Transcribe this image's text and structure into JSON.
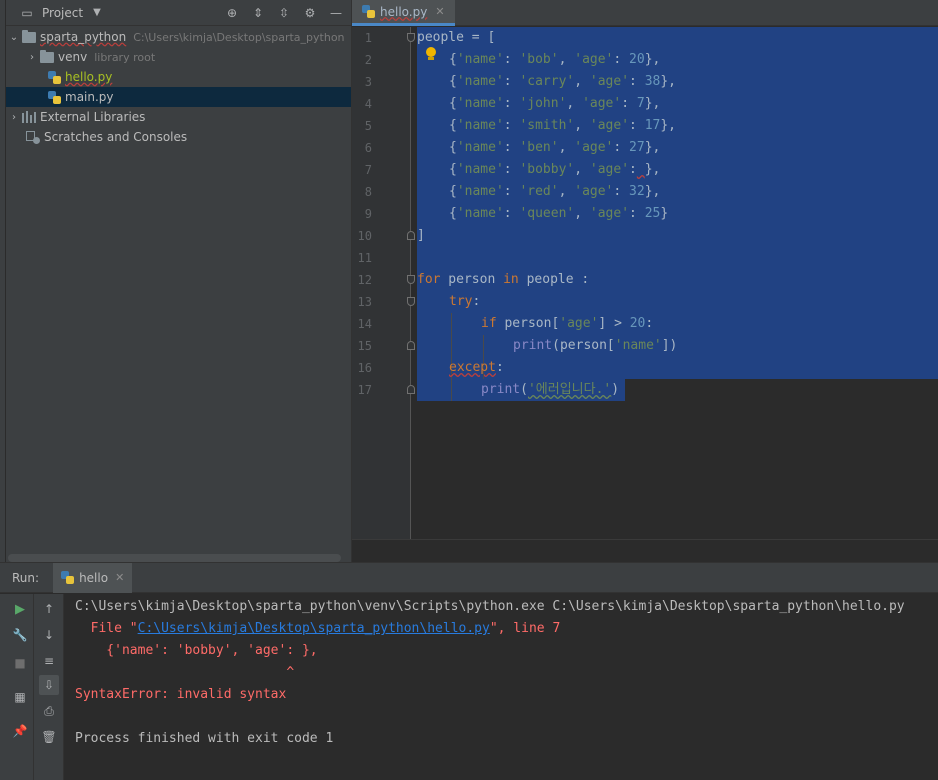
{
  "project": {
    "title": "Project",
    "root_name": "sparta_python",
    "root_path": "C:\\Users\\kimja\\Desktop\\sparta_python",
    "items": [
      {
        "label": "venv",
        "hint": "library root"
      },
      {
        "label": "hello.py"
      },
      {
        "label": "main.py"
      },
      {
        "label": "External Libraries"
      },
      {
        "label": "Scratches and Consoles"
      }
    ]
  },
  "editor": {
    "tab": "hello.py",
    "line_numbers": [
      "1",
      "2",
      "3",
      "4",
      "5",
      "6",
      "7",
      "8",
      "9",
      "10",
      "11",
      "12",
      "13",
      "14",
      "15",
      "16",
      "17"
    ],
    "code": {
      "l1": "people = [",
      "people_list": [
        {
          "name": "'bob'",
          "age": "20"
        },
        {
          "name": "'carry'",
          "age": "38"
        },
        {
          "name": "'john'",
          "age": "7"
        },
        {
          "name": "'smith'",
          "age": "17"
        },
        {
          "name": "'ben'",
          "age": "27"
        },
        {
          "name": "'bobby'",
          "age": ""
        },
        {
          "name": "'red'",
          "age": "32"
        },
        {
          "name": "'queen'",
          "age": "25"
        }
      ],
      "close_bracket": "]",
      "for_kw": "for",
      "for_var": " person ",
      "in_kw": "in",
      "for_rest": " people :",
      "try_kw": "try",
      "if_kw": "if",
      "if_cond_a": " person[",
      "if_cond_str": "'age'",
      "if_cond_b": "] > ",
      "if_num": "20",
      "print_fn": "print",
      "print_inner_a": "(person[",
      "print_inner_str": "'name'",
      "print_inner_b": "])",
      "except_kw": "except",
      "print2_str": "'에러입니다.'"
    }
  },
  "run": {
    "label": "Run:",
    "tab": "hello",
    "console": {
      "cmd": "C:\\Users\\kimja\\Desktop\\sparta_python\\venv\\Scripts\\python.exe C:\\Users\\kimja\\Desktop\\sparta_python\\hello.py",
      "file_prefix": "  File \"",
      "file_link": "C:\\Users\\kimja\\Desktop\\sparta_python\\hello.py",
      "file_suffix": "\", line 7",
      "err_line": "    {'name': 'bobby', 'age': },",
      "caret": "                           ^",
      "syntax_error": "SyntaxError: invalid syntax",
      "exit": "Process finished with exit code 1"
    }
  }
}
